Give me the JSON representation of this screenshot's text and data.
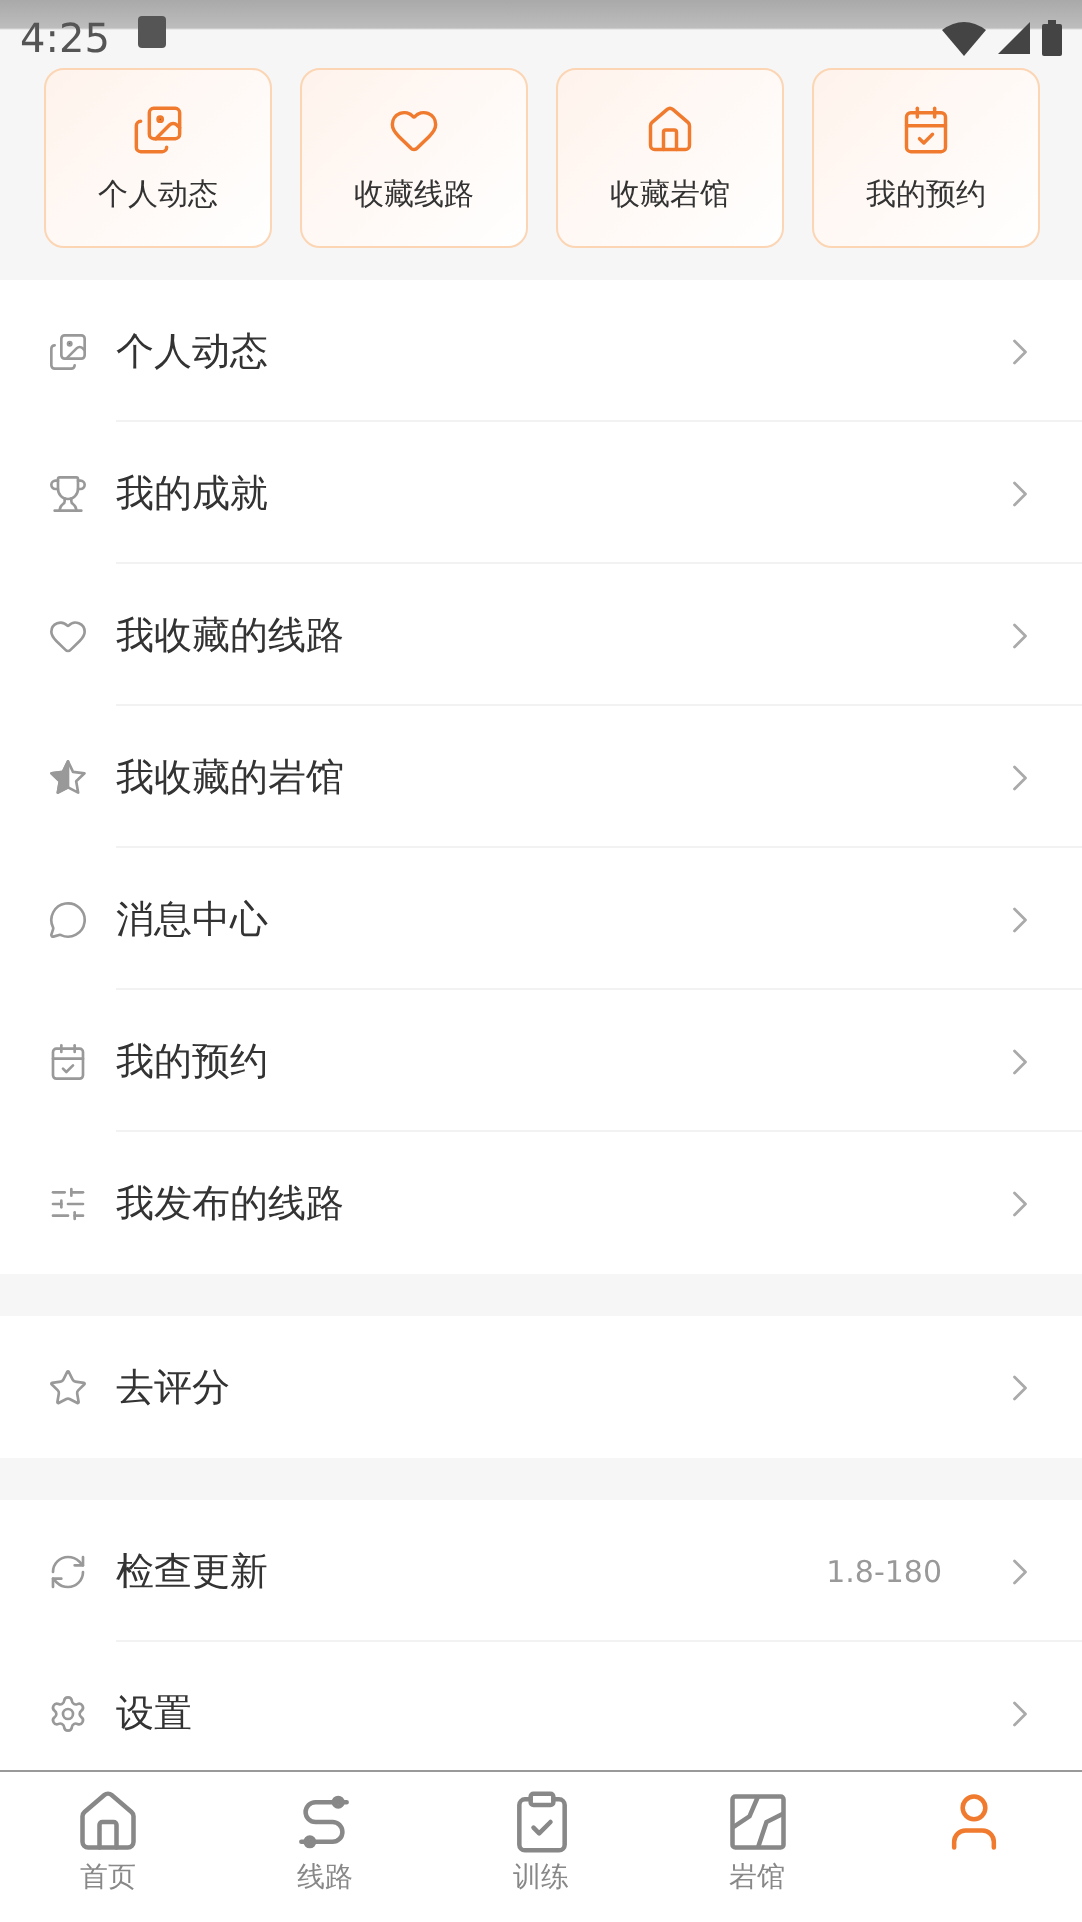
{
  "status_bar": {
    "time": "4:25"
  },
  "quick_actions": [
    {
      "label": "个人动态"
    },
    {
      "label": "收藏线路"
    },
    {
      "label": "收藏岩馆"
    },
    {
      "label": "我的预约"
    }
  ],
  "menu_groups": [
    {
      "items": [
        {
          "label": "个人动态"
        },
        {
          "label": "我的成就"
        },
        {
          "label": "我收藏的线路"
        },
        {
          "label": "我收藏的岩馆"
        },
        {
          "label": "消息中心"
        },
        {
          "label": "我的预约"
        },
        {
          "label": "我发布的线路"
        }
      ]
    },
    {
      "items": [
        {
          "label": "去评分"
        }
      ]
    },
    {
      "items": [
        {
          "label": "检查更新",
          "value": "1.8-180"
        },
        {
          "label": "设置"
        }
      ]
    }
  ],
  "tabs": [
    {
      "label": "首页",
      "selected": false
    },
    {
      "label": "线路",
      "selected": false
    },
    {
      "label": "训练",
      "selected": false
    },
    {
      "label": "岩馆",
      "selected": false
    },
    {
      "selected": true
    }
  ]
}
